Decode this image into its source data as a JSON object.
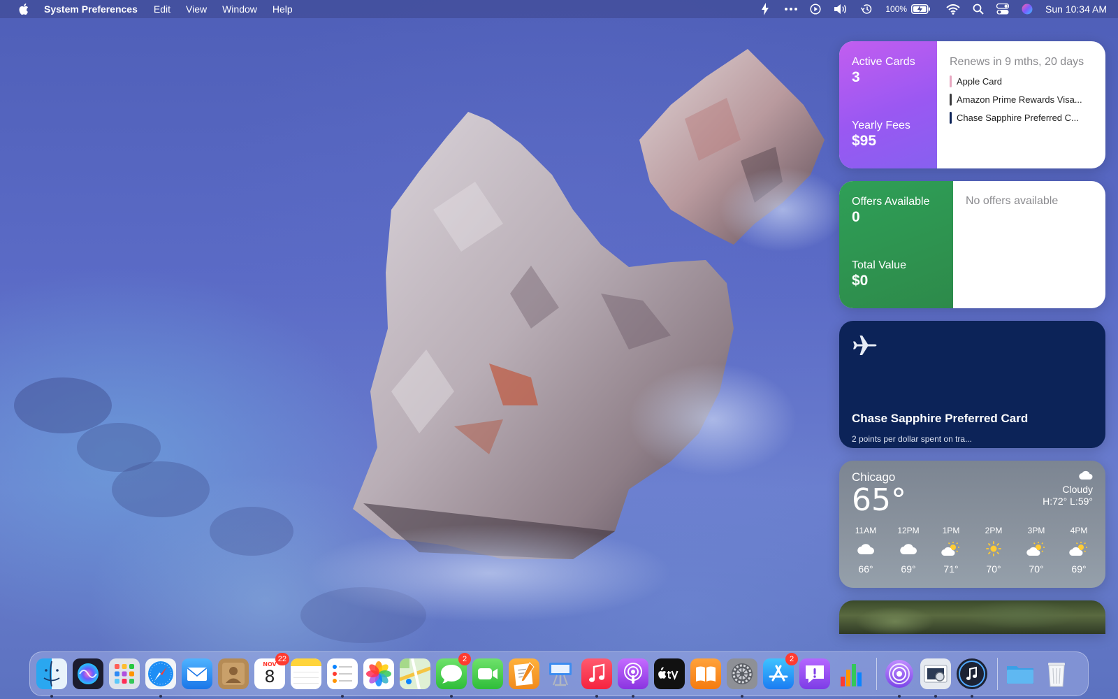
{
  "menubar": {
    "app_name": "System Preferences",
    "menus": [
      "Edit",
      "View",
      "Window",
      "Help"
    ],
    "battery_percent": "100%",
    "clock": "Sun 10:34 AM",
    "status_icons": [
      "bolt-icon",
      "more-icon",
      "play-icon",
      "volume-icon",
      "time-machine-icon",
      "battery-icon",
      "wifi-icon",
      "spotlight-icon",
      "control-center-icon",
      "siri-icon"
    ]
  },
  "cards_widget": {
    "active_label": "Active Cards",
    "active_value": "3",
    "fees_label": "Yearly Fees",
    "fees_value": "$95",
    "renew_text": "Renews in 9 mths, 20 days",
    "cards": [
      {
        "name": "Apple Card",
        "color": "#e7a7c0"
      },
      {
        "name": "Amazon Prime Rewards Visa...",
        "color": "#3a3a3c"
      },
      {
        "name": "Chase Sapphire Preferred C...",
        "color": "#0c2358"
      }
    ],
    "accent_color": "#9a58f2"
  },
  "offers_widget": {
    "offers_label": "Offers Available",
    "offers_value": "0",
    "value_label": "Total Value",
    "value_value": "$0",
    "empty_text": "No offers available",
    "accent_color": "#2f9f57"
  },
  "travel_widget": {
    "icon": "airplane-icon",
    "title": "Chase Sapphire Preferred Card",
    "subtitle": "2 points per dollar spent on tra...",
    "background_color": "#0c2358"
  },
  "weather_widget": {
    "city": "Chicago",
    "temp": "65°",
    "condition": "Cloudy",
    "hilo": "H:72° L:59°",
    "hours": [
      {
        "time": "11AM",
        "icon": "cloud-icon",
        "temp": "66°"
      },
      {
        "time": "12PM",
        "icon": "cloud-icon",
        "temp": "69°"
      },
      {
        "time": "1PM",
        "icon": "partly-sunny-icon",
        "temp": "71°"
      },
      {
        "time": "2PM",
        "icon": "sun-icon",
        "temp": "70°"
      },
      {
        "time": "3PM",
        "icon": "partly-sunny-icon",
        "temp": "70°"
      },
      {
        "time": "4PM",
        "icon": "partly-sunny-icon",
        "temp": "69°"
      }
    ]
  },
  "dock": {
    "calendar_month": "NOV",
    "calendar_day": "8",
    "badges": {
      "calendar": "22",
      "messages": "2",
      "app_store": "2"
    },
    "apps": [
      "Finder",
      "Siri",
      "Launchpad",
      "Safari",
      "Mail",
      "Contacts",
      "Calendar",
      "Notes",
      "Reminders",
      "Photos",
      "Maps",
      "Messages",
      "FaceTime",
      "Pages",
      "Keynote",
      "Music",
      "Podcasts",
      "TV",
      "Books",
      "System Preferences",
      "App Store",
      "Feedback Assistant",
      "Numbers",
      "AirDrop",
      "Preview",
      "Music Player",
      "Downloads",
      "Trash"
    ]
  }
}
